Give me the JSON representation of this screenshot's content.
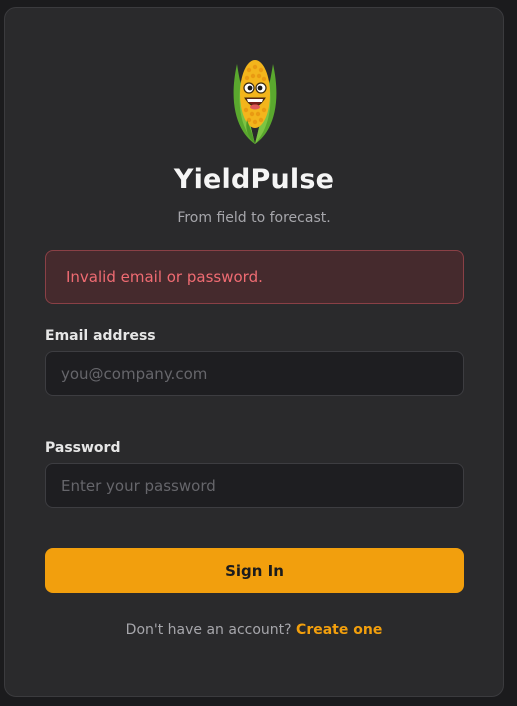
{
  "brand": {
    "logo_icon": "corn-mascot-icon",
    "name": "YieldPulse",
    "tagline": "From field to forecast."
  },
  "alert": {
    "message": "Invalid email or password."
  },
  "form": {
    "email": {
      "label": "Email address",
      "value": "",
      "placeholder": "you@company.com"
    },
    "password": {
      "label": "Password",
      "value": "",
      "placeholder": "Enter your password"
    },
    "submit_label": "Sign In"
  },
  "footer": {
    "prompt": "Don't have an account?",
    "link_label": "Create one"
  },
  "colors": {
    "accent": "#f29f0d",
    "error_text": "#ef6b72",
    "error_bg": "#452a2d",
    "card_bg": "#2a2a2c"
  }
}
